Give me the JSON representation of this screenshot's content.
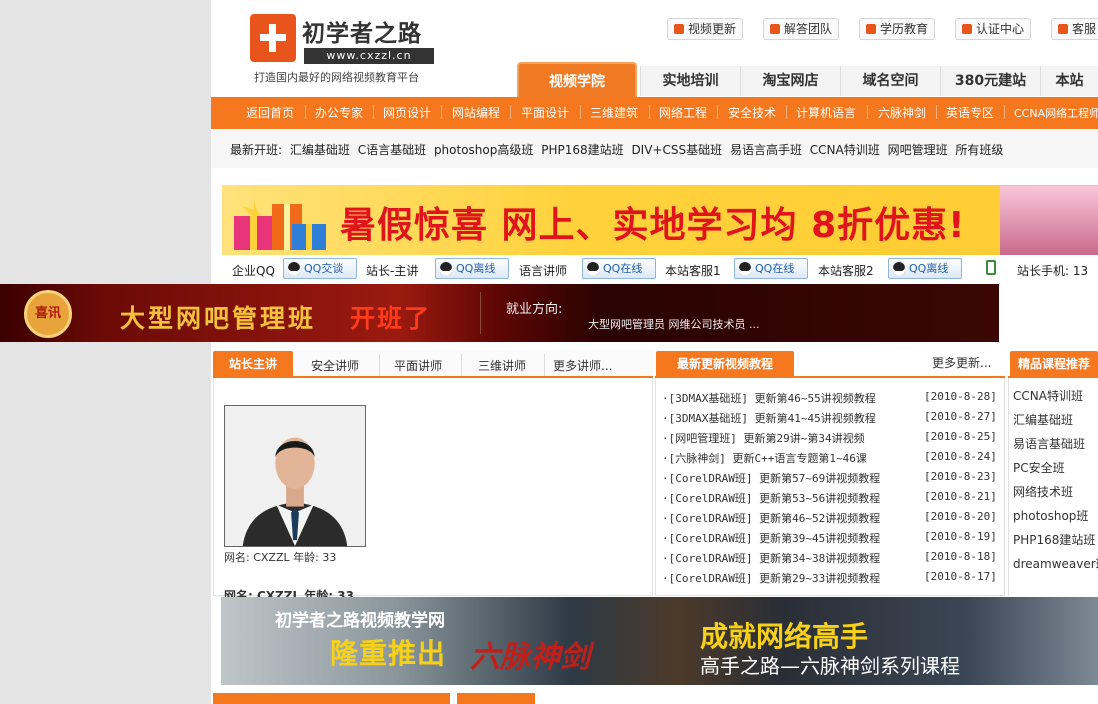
{
  "logo": {
    "title": "初学者之路",
    "url": "www.cxzzl.cn",
    "slogan": "打造国内最好的网络视频教育平台"
  },
  "top_links": [
    "视频更新",
    "解答团队",
    "学历教育",
    "认证中心",
    "客服"
  ],
  "main_tabs": {
    "active": "视频学院",
    "others": [
      "实地培训",
      "淘宝网店",
      "域名空间",
      "380元建站",
      "本站"
    ]
  },
  "nav": [
    "返回首页",
    "办公专家",
    "网页设计",
    "网站编程",
    "平面设计",
    "三维建筑",
    "网络工程",
    "安全技术",
    "计算机语言",
    "六脉神剑",
    "英语专区",
    "CCNA网络工程师"
  ],
  "new_classes": {
    "label": "最新开班:",
    "items": [
      "汇编基础班",
      "C语言基础班",
      "photoshop高级班",
      "PHP168建站班",
      "DIV+CSS基础班",
      "易语言高手班",
      "CCNA特训班",
      "网吧管理班",
      "所有班级"
    ]
  },
  "banner1": {
    "text": "暑假惊喜 网上、实地学习均 8折优惠!"
  },
  "qq": {
    "company_label": "企业QQ",
    "company_btn": "QQ交谈",
    "admin_label": "站长-主讲",
    "admin_btn": "QQ离线",
    "lang_label": "语言讲师",
    "lang_btn": "QQ在线",
    "cs1_label": "本站客服1",
    "cs1_btn": "QQ在线",
    "cs2_label": "本站客服2",
    "cs2_btn": "QQ离线",
    "phone_label": "站长手机: 13"
  },
  "banner2": {
    "badge": "喜讯",
    "title": "大型网吧管理班",
    "open": "开班了",
    "direction": "就业方向:",
    "jobs": "大型网吧管理员 网维公司技术员 ..."
  },
  "lecturers": {
    "active": "站长主讲",
    "tabs": [
      "安全讲师",
      "平面讲师",
      "三维讲师",
      "更多讲师..."
    ],
    "caption": "网名: CXZZL 年龄: 33",
    "caption2": "网名: CXZZL 年龄: 33"
  },
  "videos": {
    "title": "最新更新视频教程",
    "more": "更多更新...",
    "rows": [
      {
        "text": "·[3DMAX基础班] 更新第46~55讲视频教程",
        "date": "[2010-8-28]"
      },
      {
        "text": "·[3DMAX基础班] 更新第41~45讲视频教程",
        "date": "[2010-8-27]"
      },
      {
        "text": "·[网吧管理班] 更新第29讲~第34讲视频",
        "date": "[2010-8-25]"
      },
      {
        "text": "·[六脉神剑] 更新C++语言专题第1~46课",
        "date": "[2010-8-24]"
      },
      {
        "text": "·[CorelDRAW班] 更新第57~69讲视频教程",
        "date": "[2010-8-23]"
      },
      {
        "text": "·[CorelDRAW班] 更新第53~56讲视频教程",
        "date": "[2010-8-21]"
      },
      {
        "text": "·[CorelDRAW班] 更新第46~52讲视频教程",
        "date": "[2010-8-20]"
      },
      {
        "text": "·[CorelDRAW班] 更新第39~45讲视频教程",
        "date": "[2010-8-19]"
      },
      {
        "text": "·[CorelDRAW班] 更新第34~38讲视频教程",
        "date": "[2010-8-18]"
      },
      {
        "text": "·[CorelDRAW班] 更新第29~33讲视频教程",
        "date": "[2010-8-17]"
      }
    ]
  },
  "courses": {
    "title": "精品课程推荐",
    "items": [
      "CCNA特训班",
      "汇编基础班",
      "易语言基础班",
      "PC安全班",
      "网络技术班",
      "photoshop班",
      "PHP168建站班",
      "dreamweaver班"
    ]
  },
  "banner3": {
    "site": "初学者之路视频教学网",
    "launch": "隆重推出",
    "sword": "六脉神剑",
    "master": "成就网络高手",
    "course": "高手之路—六脉神剑系列课程"
  },
  "colors": {
    "accent": "#f5781f",
    "brand": "#e8541c",
    "gray": "#e4e4e4"
  }
}
